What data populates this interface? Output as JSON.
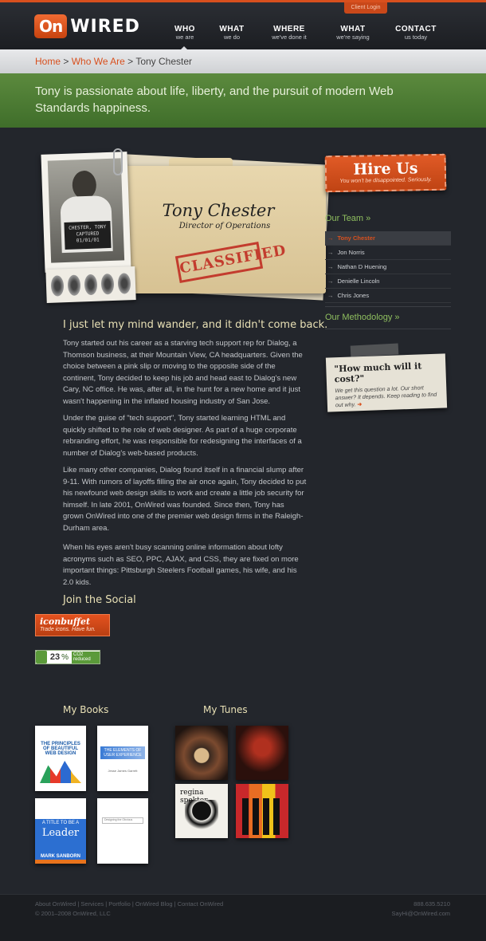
{
  "header": {
    "logo_on": "On",
    "logo_wired": "WIRED",
    "client_login": "Client Login",
    "nav": [
      {
        "title": "WHO",
        "sub": "we are"
      },
      {
        "title": "WHAT",
        "sub": "we do"
      },
      {
        "title": "WHERE",
        "sub": "we've done it"
      },
      {
        "title": "WHAT",
        "sub": "we're saying"
      },
      {
        "title": "CONTACT",
        "sub": "us today"
      }
    ]
  },
  "breadcrumb": {
    "home": "Home",
    "sep1": " > ",
    "who": "Who We Are",
    "sep2": " > ",
    "current": "Tony Chester"
  },
  "banner": "Tony is passionate about life, liberty, and the pursuit of modern Web Standards happiness.",
  "profile": {
    "name": "Tony Chester",
    "title": "Director of Operations",
    "stamp": "CLASSIFIED",
    "mugshot_line1": "CHESTER, TONY",
    "mugshot_line2": "CAPTURED",
    "mugshot_line3": "01/01/01"
  },
  "main": {
    "quote": "I just let my mind wander, and it didn't come back.",
    "paragraphs": [
      "Tony started out his career as a starving tech support rep for Dialog, a Thomson business, at their Mountain View, CA headquarters. Given the choice between a pink slip or moving to the opposite side of the continent, Tony decided to keep his job and head east to Dialog's new Cary, NC office. He was, after all, in the hunt for a new home and it just wasn't happening in the inflated housing industry of San Jose.",
      "Under the guise of \"tech support\", Tony started learning HTML and quickly shifted to the role of web designer. As part of a huge corporate rebranding effort, he was responsible for redesigning the interfaces of a number of Dialog's web-based products.",
      "Like many other companies, Dialog found itself in a financial slump after 9-11. With rumors of layoffs filling the air once again, Tony decided to put his newfound web design skills to work and create a little job security for himself. In late 2001, OnWired was founded. Since then, Tony has grown OnWired into one of the premier web design firms in the Raleigh-Durham area.",
      "When his eyes aren't busy scanning online information about lofty acronyms such as SEO, PPC, AJAX, and CSS, they are fixed on more important things: Pittsburgh Steelers Football games, his wife, and his 2.0 kids."
    ],
    "social_heading": "Join the Social",
    "iconbuffet_name": "iconbuffet",
    "iconbuffet_tag": "Trade icons. Have fun.",
    "co2_value": "23",
    "co2_unit": "%",
    "co2_label": "CO2 reduced"
  },
  "sidebar": {
    "hire_title": "Hire Us",
    "hire_sub": "You won't be disappointed. Seriously.",
    "team_heading": "Our Team »",
    "team": [
      "Tony Chester",
      "Jon Norris",
      "Nathan D Huening",
      "Denielle Lincoln",
      "Chris Jones"
    ],
    "methodology_heading": "Our Methodology »",
    "cost_title": "\"How much will it cost?\"",
    "cost_body": "We get this question a lot. Our short answer? It depends. Keep reading to find out why.",
    "cost_arrow": "➜"
  },
  "books": {
    "heading": "My Books",
    "b1_title": "THE PRINCIPLES OF BEAUTIFUL WEB DESIGN",
    "b2_title": "THE ELEMENTS OF USER EXPERIENCE",
    "b2_author": "Jesse James Garrett",
    "b3_top": "YOU DON'T NEED A TITLE TO BE A",
    "b3_big": "Leader",
    "b3_author": "MARK SANBORN",
    "b4_title": "Designing the Obvious"
  },
  "tunes": {
    "heading": "My Tunes",
    "t3_title": "regina spektor"
  },
  "footer": {
    "links": "About OnWired | Services | Portfolio | OnWired Blog | Contact OnWired",
    "copy": "© 2001–2008 OnWired, LLC",
    "phone": "888.635.5210",
    "email": "SayHi@OnWired.com"
  }
}
